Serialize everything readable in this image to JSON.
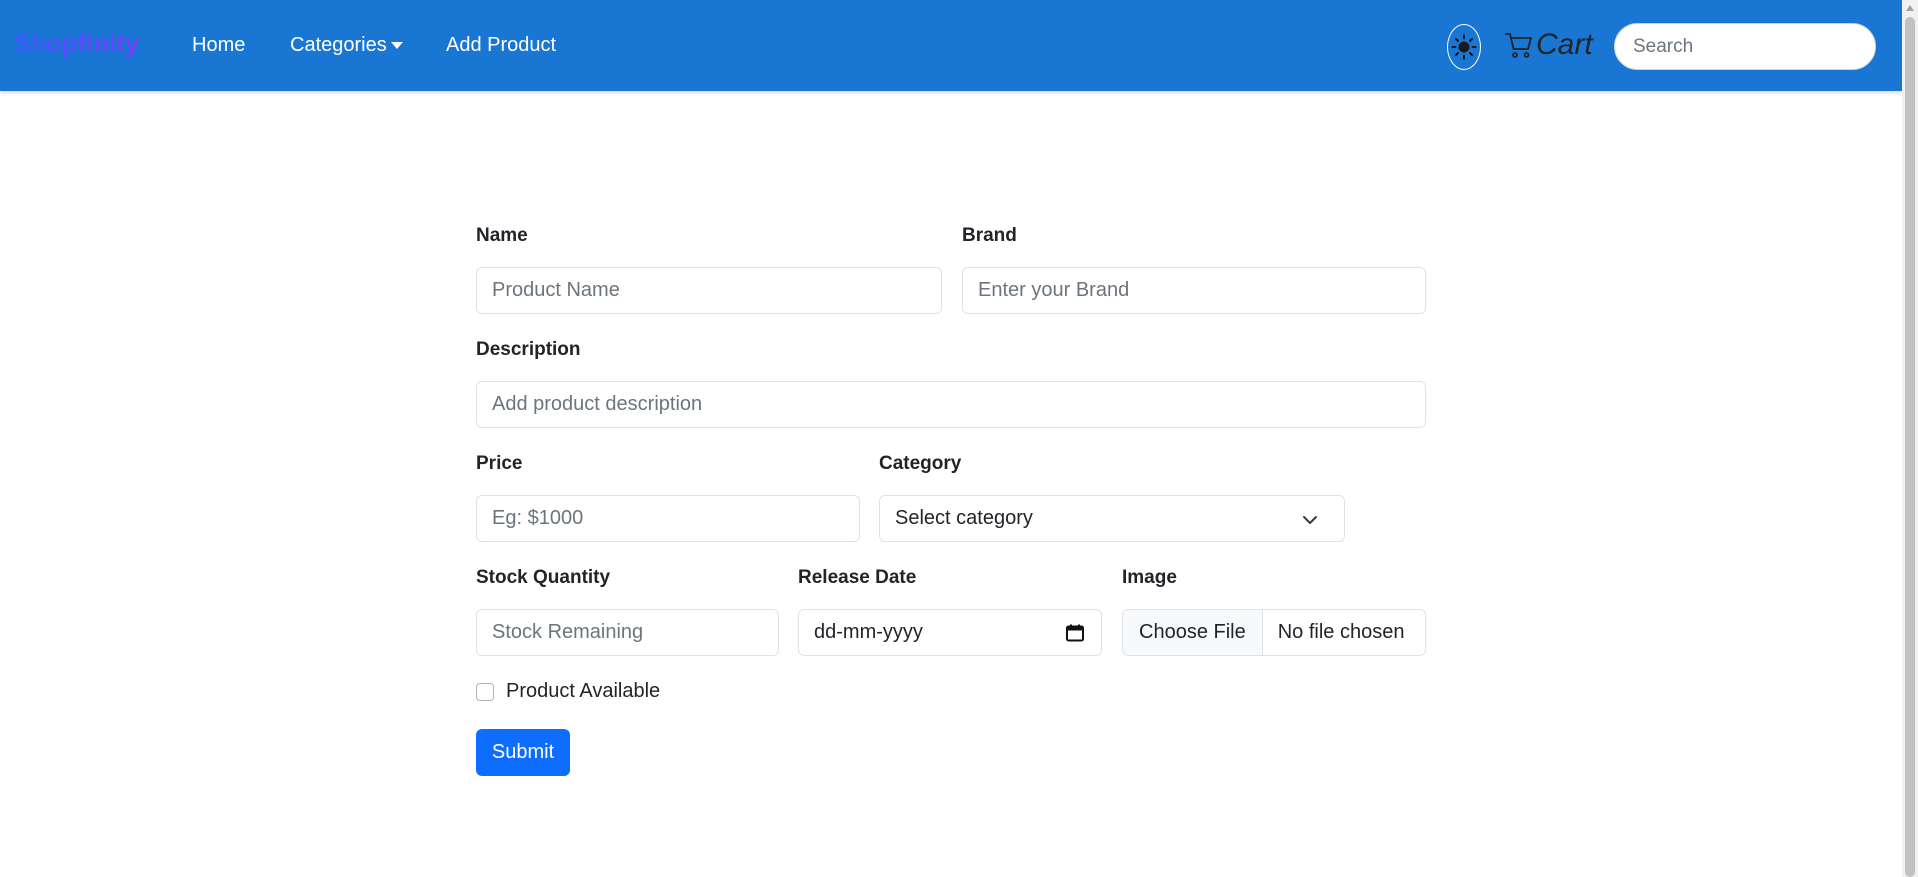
{
  "navbar": {
    "brand": "Shopfinity",
    "links": [
      "Home",
      "Categories",
      "Add Product"
    ],
    "cart_label": "Cart",
    "search_placeholder": "Search",
    "theme_icon": "sun-icon",
    "cart_icon": "cart-icon"
  },
  "form": {
    "name": {
      "label": "Name",
      "placeholder": "Product Name"
    },
    "brand": {
      "label": "Brand",
      "placeholder": "Enter your Brand"
    },
    "description": {
      "label": "Description",
      "placeholder": "Add product description"
    },
    "price": {
      "label": "Price",
      "placeholder": "Eg: $1000"
    },
    "category": {
      "label": "Category",
      "selected": "Select category"
    },
    "stock": {
      "label": "Stock Quantity",
      "placeholder": "Stock Remaining"
    },
    "release_date": {
      "label": "Release Date",
      "value": "dd-mm-yyyy"
    },
    "image": {
      "label": "Image",
      "button": "Choose File",
      "status": "No file chosen"
    },
    "available": {
      "label": "Product Available",
      "checked": false
    },
    "submit_label": "Submit"
  },
  "colors": {
    "navbar": "#1976d2",
    "primary_button": "#0d6efd",
    "brand_gradient_start": "#3b5bff",
    "brand_gradient_end": "#7b3cff"
  }
}
